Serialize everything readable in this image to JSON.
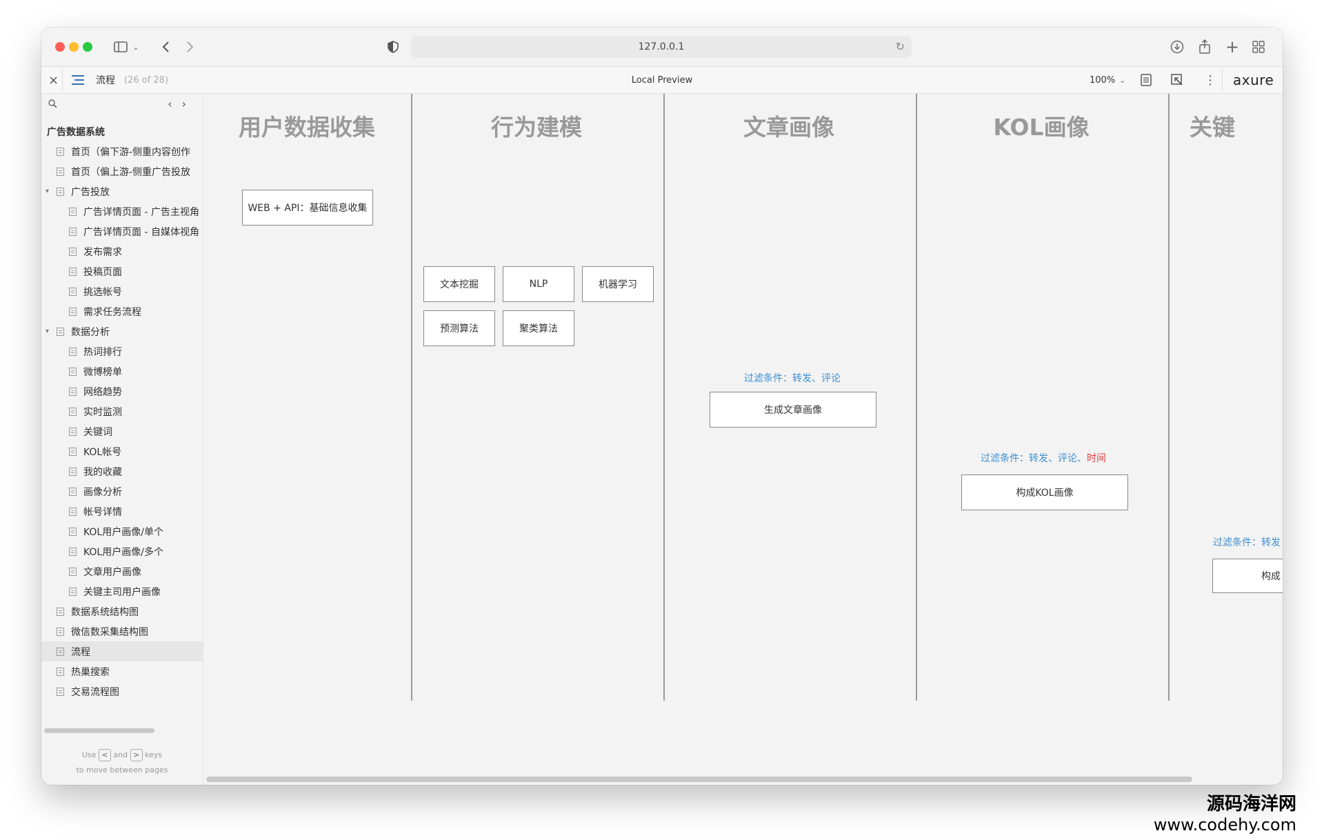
{
  "browser": {
    "url": "127.0.0.1"
  },
  "axure_bar": {
    "close": "×",
    "page_name": "流程",
    "page_count": "(26 of 28)",
    "center_title": "Local Preview",
    "zoom": "100%",
    "brand": "axure"
  },
  "sidebar": {
    "hint_line1_use": "Use",
    "hint_and": "and",
    "hint_keys": "keys",
    "hint_line2": "to move between pages",
    "key_left": "<",
    "key_right": ">",
    "root": "广告数据系统",
    "items": [
      {
        "label": "首页（偏下游-侧重内容创作",
        "level": 1
      },
      {
        "label": "首页（偏上游-侧重广告投放",
        "level": 1
      },
      {
        "label": "广告投放",
        "level": 1,
        "folder": true
      },
      {
        "label": "广告详情页面 - 广告主视角",
        "level": 2
      },
      {
        "label": "广告详情页面 - 自媒体视角",
        "level": 2
      },
      {
        "label": "发布需求",
        "level": 2
      },
      {
        "label": "投稿页面",
        "level": 2
      },
      {
        "label": "挑选帐号",
        "level": 2
      },
      {
        "label": "需求任务流程",
        "level": 2
      },
      {
        "label": "数据分析",
        "level": 1,
        "folder": true
      },
      {
        "label": "热词排行",
        "level": 2
      },
      {
        "label": "微博榜单",
        "level": 2
      },
      {
        "label": "网络趋势",
        "level": 2
      },
      {
        "label": "实时监测",
        "level": 2
      },
      {
        "label": "关键词",
        "level": 2
      },
      {
        "label": "KOL帐号",
        "level": 2
      },
      {
        "label": "我的收藏",
        "level": 2
      },
      {
        "label": "画像分析",
        "level": 2
      },
      {
        "label": "帐号详情",
        "level": 2
      },
      {
        "label": "KOL用户画像/单个",
        "level": 2
      },
      {
        "label": "KOL用户画像/多个",
        "level": 2
      },
      {
        "label": "文章用户画像",
        "level": 2
      },
      {
        "label": "关键主司用户画像",
        "level": 2
      },
      {
        "label": "数据系统结构图",
        "level": 1
      },
      {
        "label": "微信数采集结构图",
        "level": 1
      },
      {
        "label": "流程",
        "level": 1,
        "selected": true
      },
      {
        "label": "热巢搜索",
        "level": 1
      },
      {
        "label": "交易流程图",
        "level": 1
      }
    ]
  },
  "canvas": {
    "lanes": [
      "用户数据收集",
      "行为建模",
      "文章画像",
      "KOL画像",
      "关键"
    ],
    "collect_box": "WEB + API：基础信息收集",
    "model_boxes": [
      "文本挖掘",
      "NLP",
      "机器学习",
      "预测算法",
      "聚类算法"
    ],
    "article_cond": "过滤条件：转发、评论",
    "article_box": "生成文章画像",
    "kol_cond": "过滤条件：转发、评论、",
    "kol_cond_red": "时间",
    "kol_box": "构成KOL画像",
    "key_cond": "过滤条件：转发",
    "key_box": "构成"
  },
  "watermark": {
    "line1": "源码海洋网",
    "line2": "www.codehy.com"
  },
  "colors": {
    "accent_blue": "#3d8fd4",
    "accent_red": "#e03a3a",
    "lane_title": "#999999"
  }
}
